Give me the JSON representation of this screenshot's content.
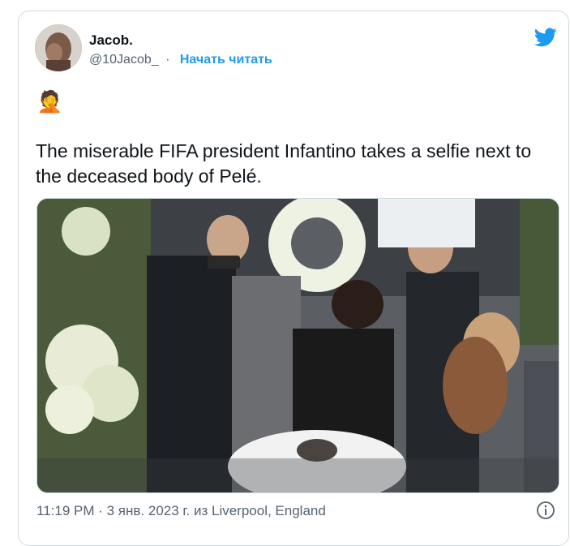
{
  "tweet": {
    "author": {
      "display_name": "Jacob.",
      "handle": "@10Jacob_",
      "separator": "·",
      "follow_label": "Начать читать"
    },
    "emoji": "🤦",
    "text": "The miserable FIFA president Infantino takes a selfie next to the deceased body of Pelé.",
    "footer": {
      "timestamp": "11:19 PM · 3 янв. 2023 г. из Liverpool, England"
    },
    "icons": {
      "brand": "twitter-bird-icon",
      "info": "info-icon"
    },
    "colors": {
      "accent": "#1d9bf0",
      "secondary_text": "#536471"
    }
  }
}
